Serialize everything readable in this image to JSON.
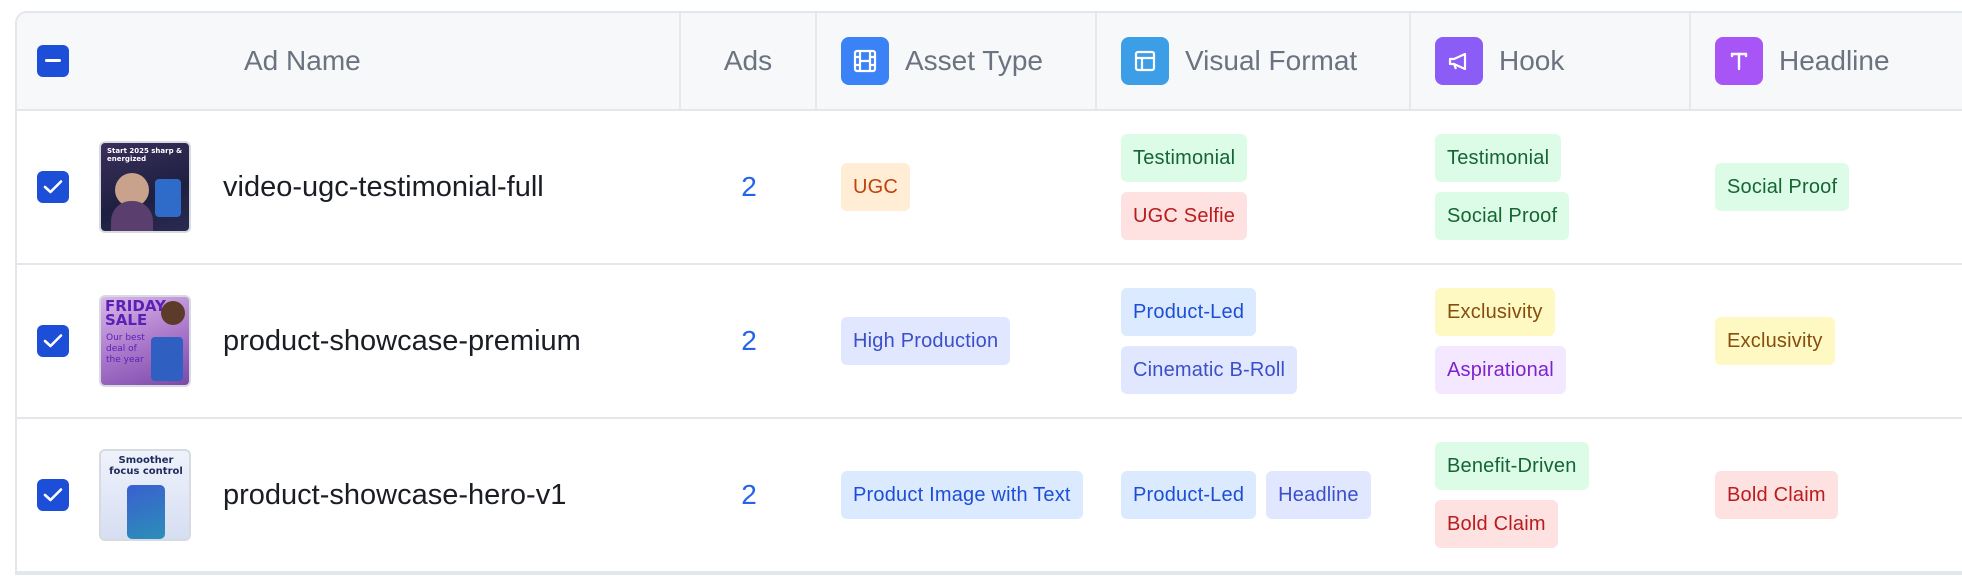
{
  "header": {
    "ad_name": "Ad Name",
    "ads": "Ads",
    "asset_type": "Asset Type",
    "visual_format": "Visual Format",
    "hook": "Hook",
    "headline": "Headline",
    "icons": {
      "asset_type": "film-icon",
      "visual_format": "layout-icon",
      "hook": "megaphone-icon",
      "headline": "text-icon"
    },
    "icon_colors": {
      "asset_type": "#3b82f6",
      "visual_format": "#3b9ee6",
      "hook": "#8b5cf6",
      "headline": "#a855f7"
    }
  },
  "rows": [
    {
      "name": "video-ugc-testimonial-full",
      "ads": "2",
      "thumb_text": "Start 2025 sharp & energized",
      "asset_type": [
        {
          "label": "UGC",
          "color": "orange"
        }
      ],
      "visual_format": [
        {
          "label": "Testimonial",
          "color": "green"
        },
        {
          "label": "UGC Selfie",
          "color": "red"
        }
      ],
      "hook": [
        {
          "label": "Testimonial",
          "color": "green"
        },
        {
          "label": "Social Proof",
          "color": "green"
        }
      ],
      "headline": [
        {
          "label": "Social Proof",
          "color": "green"
        }
      ]
    },
    {
      "name": "product-showcase-premium",
      "ads": "2",
      "thumb_text": "FRIDAY SALE",
      "thumb_sub": "Our best deal of the year",
      "asset_type": [
        {
          "label": "High Production",
          "color": "indigo"
        }
      ],
      "visual_format": [
        {
          "label": "Product-Led",
          "color": "blue"
        },
        {
          "label": "Cinematic B-Roll",
          "color": "indigo"
        }
      ],
      "hook": [
        {
          "label": "Exclusivity",
          "color": "yellow"
        },
        {
          "label": "Aspirational",
          "color": "purple"
        }
      ],
      "headline": [
        {
          "label": "Exclusivity",
          "color": "yellow"
        }
      ]
    },
    {
      "name": "product-showcase-hero-v1",
      "ads": "2",
      "thumb_text": "Smoother focus control",
      "asset_type": [
        {
          "label": "Product Image with Text",
          "color": "blue"
        }
      ],
      "visual_format": [
        {
          "label": "Product-Led",
          "color": "blue"
        },
        {
          "label": "Headline",
          "color": "bluepill"
        }
      ],
      "hook": [
        {
          "label": "Benefit-Driven",
          "color": "green"
        },
        {
          "label": "Bold Claim",
          "color": "red"
        }
      ],
      "headline": [
        {
          "label": "Bold Claim",
          "color": "red"
        }
      ]
    }
  ]
}
